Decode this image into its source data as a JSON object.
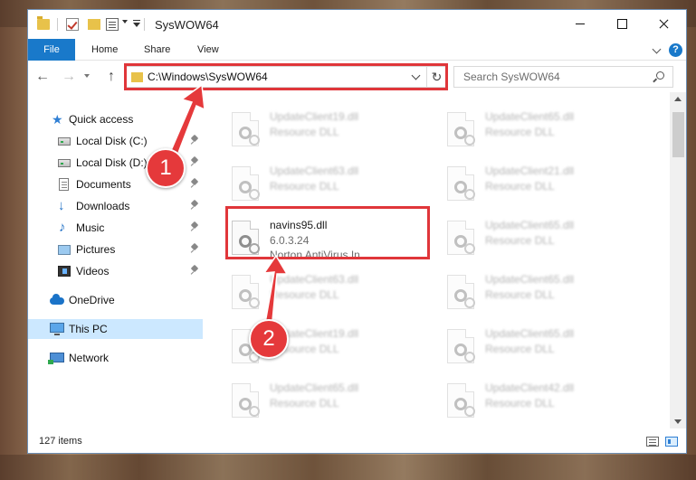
{
  "window": {
    "title": "SysWOW64",
    "controls": {
      "minimize": "",
      "maximize": "",
      "close": ""
    }
  },
  "ribbon": {
    "tabs": [
      {
        "label": "File"
      },
      {
        "label": "Home"
      },
      {
        "label": "Share"
      },
      {
        "label": "View"
      }
    ],
    "help_label": "?"
  },
  "navbar": {
    "back_glyph": "←",
    "forward_glyph": "→",
    "up_glyph": "↑",
    "refresh_glyph": "↻",
    "address": "C:\\Windows\\SysWOW64",
    "search_placeholder": "Search SysWOW64"
  },
  "sidebar": {
    "items": [
      {
        "label": "Quick access",
        "icon": "star-icon"
      },
      {
        "label": "Local Disk (C:)",
        "icon": "drive-icon",
        "pinned": true
      },
      {
        "label": "Local Disk (D:)",
        "icon": "drive-icon",
        "pinned": true
      },
      {
        "label": "Documents",
        "icon": "documents-icon",
        "pinned": true
      },
      {
        "label": "Downloads",
        "icon": "downloads-icon",
        "pinned": true
      },
      {
        "label": "Music",
        "icon": "music-icon",
        "pinned": true
      },
      {
        "label": "Pictures",
        "icon": "pictures-icon",
        "pinned": true
      },
      {
        "label": "Videos",
        "icon": "videos-icon",
        "pinned": true
      },
      {
        "label": "OneDrive",
        "icon": "onedrive-icon"
      },
      {
        "label": "This PC",
        "icon": "pc-icon",
        "selected": true
      },
      {
        "label": "Network",
        "icon": "network-icon"
      }
    ]
  },
  "files": {
    "left": [
      {
        "name": "UpdateClient19.dll",
        "line1": "Resource DLL",
        "line2": ""
      },
      {
        "name": "UpdateClient63.dll",
        "line1": "Resource DLL",
        "line2": ""
      },
      {
        "name": "navins95.dll",
        "line1": "6.0.3.24",
        "line2": "Norton AntiVirus In..."
      },
      {
        "name": "UpdateClient63.dll",
        "line1": "Resource DLL",
        "line2": ""
      },
      {
        "name": "UpdateClient19.dll",
        "line1": "Resource DLL",
        "line2": ""
      },
      {
        "name": "UpdateClient65.dll",
        "line1": "Resource DLL",
        "line2": ""
      }
    ],
    "right": [
      {
        "name": "UpdateClient65.dll",
        "line1": "Resource DLL"
      },
      {
        "name": "UpdateClient21.dll",
        "line1": "Resource DLL"
      },
      {
        "name": "UpdateClient65.dll",
        "line1": "Resource DLL"
      },
      {
        "name": "UpdateClient65.dll",
        "line1": "Resource DLL"
      },
      {
        "name": "UpdateClient65.dll",
        "line1": "Resource DLL"
      },
      {
        "name": "UpdateClient42.dll",
        "line1": "Resource DLL"
      }
    ]
  },
  "status": {
    "item_count": "127 items"
  },
  "callouts": {
    "step1": "1",
    "step2": "2"
  },
  "colors": {
    "accent": "#1979ca",
    "highlight": "#e0363a",
    "callout": "#e5393b",
    "selection": "#cce8ff"
  }
}
